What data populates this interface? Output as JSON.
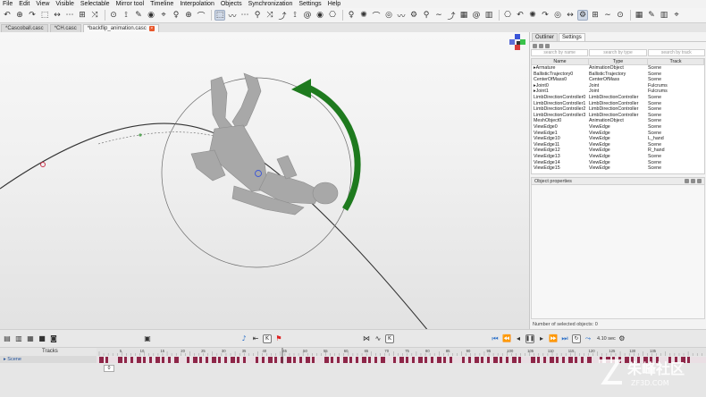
{
  "menu": [
    "File",
    "Edit",
    "View",
    "Visible",
    "Selectable",
    "Mirror tool",
    "Timeline",
    "Interpolation",
    "Objects",
    "Synchronization",
    "Settings",
    "Help"
  ],
  "toolbar_icons": [
    "undo-icon",
    "redo-icon",
    "move-icon",
    "graph-icon",
    "orbit-icon",
    "pen-icon",
    "snap-icon",
    "magnet-icon",
    "select-rect-icon",
    "node-icon",
    "connect-icon",
    "bone-icon",
    "joint-icon",
    "figure-icon",
    "arc-icon",
    "wave-icon",
    "pose-icon",
    "trajectory-icon",
    "spiral-icon",
    "camera-icon",
    "light-icon",
    "target-icon",
    "gear-icon",
    "wave2-icon",
    "grid-icon",
    "split-icon"
  ],
  "doc_tabs": [
    {
      "label": "*Cascoball.casc",
      "selected": false
    },
    {
      "label": "*CH.casc",
      "selected": false
    },
    {
      "label": "*backflip_animation.casc",
      "selected": true
    }
  ],
  "panel_tabs": [
    "Outliner",
    "Settings"
  ],
  "search": {
    "name": "search by name",
    "type": "search by type",
    "track": "search by track"
  },
  "outliner": {
    "columns": [
      "Name",
      "Type",
      "Track"
    ],
    "rows": [
      [
        "▸Armature",
        "AnimationObject",
        "Scene"
      ],
      [
        "BallisticTrajectory0",
        "BallisticTrajectory",
        "Scene"
      ],
      [
        "CenterOfMass0",
        "CenterOfMass",
        "Scene"
      ],
      [
        "▸Joint0",
        "Joint",
        "Fulcrums"
      ],
      [
        "▸Joint1",
        "Joint",
        "Fulcrums"
      ],
      [
        "LimbDirectionController0",
        "LimbDirectionController",
        "Scene"
      ],
      [
        "LimbDirectionController1",
        "LimbDirectionController",
        "Scene"
      ],
      [
        "LimbDirectionController2",
        "LimbDirectionController",
        "Scene"
      ],
      [
        "LimbDirectionController3",
        "LimbDirectionController",
        "Scene"
      ],
      [
        "MeshObject0",
        "AnimationObject",
        "Scene"
      ],
      [
        "ViewEdge0",
        "ViewEdge",
        "Scene"
      ],
      [
        "ViewEdge1",
        "ViewEdge",
        "Scene"
      ],
      [
        "ViewEdge10",
        "ViewEdge",
        "L_hand"
      ],
      [
        "ViewEdge11",
        "ViewEdge",
        "Scene"
      ],
      [
        "ViewEdge12",
        "ViewEdge",
        "R_hand"
      ],
      [
        "ViewEdge13",
        "ViewEdge",
        "Scene"
      ],
      [
        "ViewEdge14",
        "ViewEdge",
        "Scene"
      ],
      [
        "ViewEdge15",
        "ViewEdge",
        "Scene"
      ]
    ]
  },
  "object_properties_label": "Object properties",
  "selected_count_label": "Number of selected objects: 0",
  "fps_label": "4.10 sec",
  "timeline": {
    "header": "Tracks",
    "track_name": "▸ Scene",
    "current_frame": "0",
    "ticks": [
      "5",
      "10",
      "15",
      "20",
      "25",
      "30",
      "35",
      "40",
      "45",
      "50",
      "55",
      "60",
      "65",
      "70",
      "75",
      "80",
      "85",
      "90",
      "95",
      "100",
      "105",
      "110",
      "115",
      "120",
      "125",
      "130",
      "135",
      "140",
      "145"
    ]
  },
  "watermark": {
    "text": "朱峰社区",
    "sub": "ZF3D.COM"
  },
  "colors": {
    "accent_green": "#1e7a1e",
    "key_maroon": "#8e2648",
    "gizmo_blue": "#3a55d8",
    "gizmo_red": "#d83a3a",
    "gizmo_green": "#3ac24a"
  }
}
